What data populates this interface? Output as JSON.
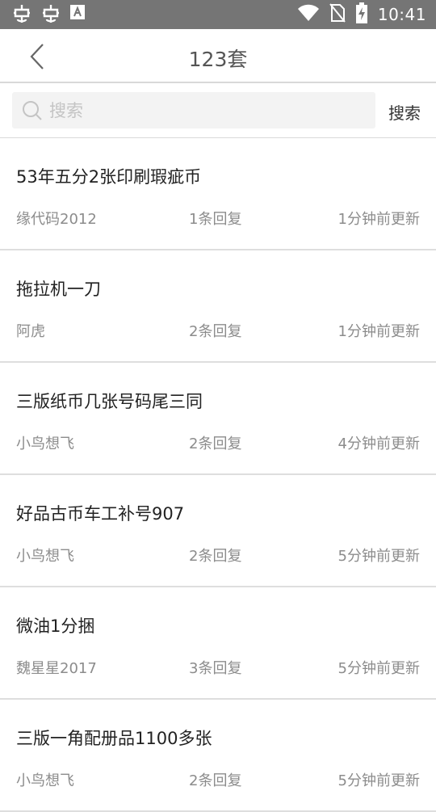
{
  "status_bar": {
    "time": "10:41",
    "icons": [
      "bug-icon",
      "bug-icon",
      "a-box-icon",
      "wifi-icon",
      "no-sim-icon",
      "battery-charging-icon"
    ]
  },
  "header": {
    "title": "123套"
  },
  "search": {
    "placeholder": "搜索",
    "value": "",
    "button_label": "搜索"
  },
  "posts": [
    {
      "title": "53年五分2张印刷瑕疵币",
      "author": "缘代码2012",
      "replies": "1条回复",
      "updated": "1分钟前更新"
    },
    {
      "title": "拖拉机一刀",
      "author": "阿虎",
      "replies": "2条回复",
      "updated": "1分钟前更新"
    },
    {
      "title": "三版纸币几张号码尾三同",
      "author": "小鸟想飞",
      "replies": "2条回复",
      "updated": "4分钟前更新"
    },
    {
      "title": "好品古币车工补号907",
      "author": "小鸟想飞",
      "replies": "2条回复",
      "updated": "5分钟前更新"
    },
    {
      "title": "微油1分捆",
      "author": "魏星星2017",
      "replies": "3条回复",
      "updated": "5分钟前更新"
    },
    {
      "title": "三版一角配册品1100多张",
      "author": "小鸟想飞",
      "replies": "2条回复",
      "updated": "5分钟前更新"
    }
  ]
}
